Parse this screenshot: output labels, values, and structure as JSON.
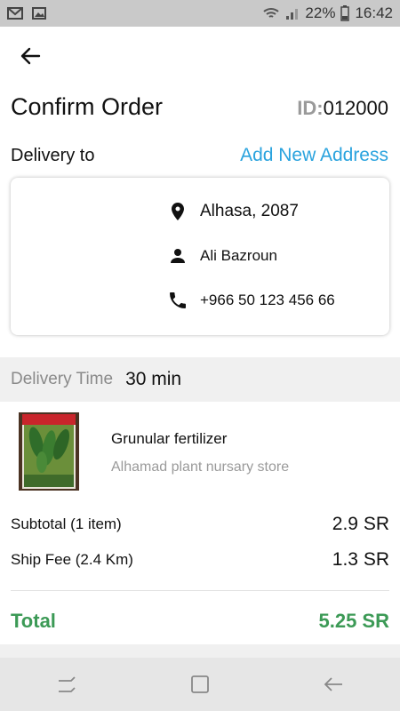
{
  "status_bar": {
    "battery": "22%",
    "time": "16:42"
  },
  "header": {
    "title": "Confirm Order",
    "id_label": "ID:",
    "id_value": "012000"
  },
  "delivery": {
    "label": "Delivery to",
    "add_address": "Add New Address",
    "location": "Alhasa, 2087",
    "name": "Ali Bazroun",
    "phone": "+966 50 123 456 66"
  },
  "delivery_time": {
    "label": "Delivery Time",
    "value": "30 min"
  },
  "product": {
    "name": "Grunular fertilizer",
    "store": "Alhamad plant nursary store"
  },
  "summary": {
    "subtotal_label": "Subtotal (1 item)",
    "subtotal_value": "2.9 SR",
    "ship_label": "Ship Fee (2.4 Km)",
    "ship_value": "1.3 SR",
    "total_label": "Total",
    "total_value": "5.25 SR"
  },
  "colors": {
    "accent_blue": "#2aa3de",
    "total_green": "#3c9a56"
  }
}
